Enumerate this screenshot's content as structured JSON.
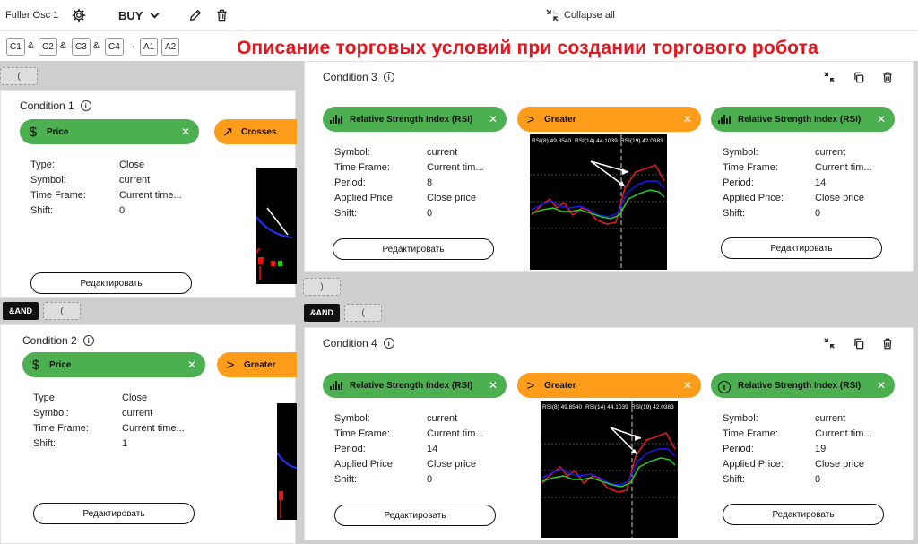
{
  "toolbar": {
    "strategy_name": "Fuller Osc 1",
    "direction": "BUY",
    "collapse_all": "Collapse all"
  },
  "formula": {
    "chips": [
      "C1",
      "C2",
      "C3",
      "C4",
      "A1",
      "A2"
    ],
    "and_symbol": "&",
    "arrow": "→"
  },
  "banner": "Описание торговых условий при создании торгового робота",
  "groups": {
    "open": "(",
    "close": ")",
    "and": "&AND"
  },
  "edit_label": "Редактировать",
  "conditions": [
    {
      "title": "Condition 1",
      "left_pill": "Price",
      "op_pill": "Crosses",
      "params": [
        {
          "k": "Type:",
          "v": "Close"
        },
        {
          "k": "Symbol:",
          "v": "current"
        },
        {
          "k": "Time Frame:",
          "v": "Current time..."
        },
        {
          "k": "Shift:",
          "v": "0"
        }
      ]
    },
    {
      "title": "Condition 2",
      "left_pill": "Price",
      "op_pill": "Greater",
      "params": [
        {
          "k": "Type:",
          "v": "Close"
        },
        {
          "k": "Symbol:",
          "v": "current"
        },
        {
          "k": "Time Frame:",
          "v": "Current time..."
        },
        {
          "k": "Shift:",
          "v": "1"
        }
      ]
    },
    {
      "title": "Condition 3",
      "left_pill": "Relative Strength Index (RSI)",
      "op_pill": "Greater",
      "right_pill": "Relative Strength Index (RSI)",
      "left_params": [
        {
          "k": "Symbol:",
          "v": "current"
        },
        {
          "k": "Time Frame:",
          "v": "Current tim..."
        },
        {
          "k": "Period:",
          "v": "8"
        },
        {
          "k": "Applied Price:",
          "v": "Close price"
        },
        {
          "k": "Shift:",
          "v": "0"
        }
      ],
      "right_params": [
        {
          "k": "Symbol:",
          "v": "current"
        },
        {
          "k": "Time Frame:",
          "v": "Current tim..."
        },
        {
          "k": "Period:",
          "v": "14"
        },
        {
          "k": "Applied Price:",
          "v": "Close price"
        },
        {
          "k": "Shift:",
          "v": "0"
        }
      ],
      "chart_legend": [
        "RSI(8) 49.8540",
        "RSI(14) 44.1039",
        "RSI(19) 42.0383"
      ]
    },
    {
      "title": "Condition 4",
      "left_pill": "Relative Strength Index (RSI)",
      "op_pill": "Greater",
      "right_pill": "Relative Strength Index (RSI)",
      "left_params": [
        {
          "k": "Symbol:",
          "v": "current"
        },
        {
          "k": "Time Frame:",
          "v": "Current tim..."
        },
        {
          "k": "Period:",
          "v": "14"
        },
        {
          "k": "Applied Price:",
          "v": "Close price"
        },
        {
          "k": "Shift:",
          "v": "0"
        }
      ],
      "right_params": [
        {
          "k": "Symbol:",
          "v": "current"
        },
        {
          "k": "Time Frame:",
          "v": "Current tim..."
        },
        {
          "k": "Period:",
          "v": "19"
        },
        {
          "k": "Applied Price:",
          "v": "Close price"
        },
        {
          "k": "Shift:",
          "v": "0"
        }
      ],
      "chart_legend": [
        "RSI(8) 49.8540",
        "RSI(14) 44.1039",
        "RSI(19) 42.0383"
      ]
    }
  ],
  "colors": {
    "green_pill": "#4caf50",
    "orange_pill": "#ff9c1a",
    "banner_red": "#e8141b",
    "rsi8": "#ff1a1a",
    "rsi14": "#1a1aff",
    "rsi19": "#22dd22"
  },
  "icons": {
    "settings": "gear-icon",
    "edit": "pencil-icon",
    "delete": "trash-icon",
    "collapse": "collapse-icon",
    "copy": "copy-icon",
    "info": "info-icon",
    "price": "dollar-icon",
    "crosses": "arrow-up-right-icon",
    "greater": "greater-than-icon",
    "indicator": "indicator-bars-icon"
  }
}
